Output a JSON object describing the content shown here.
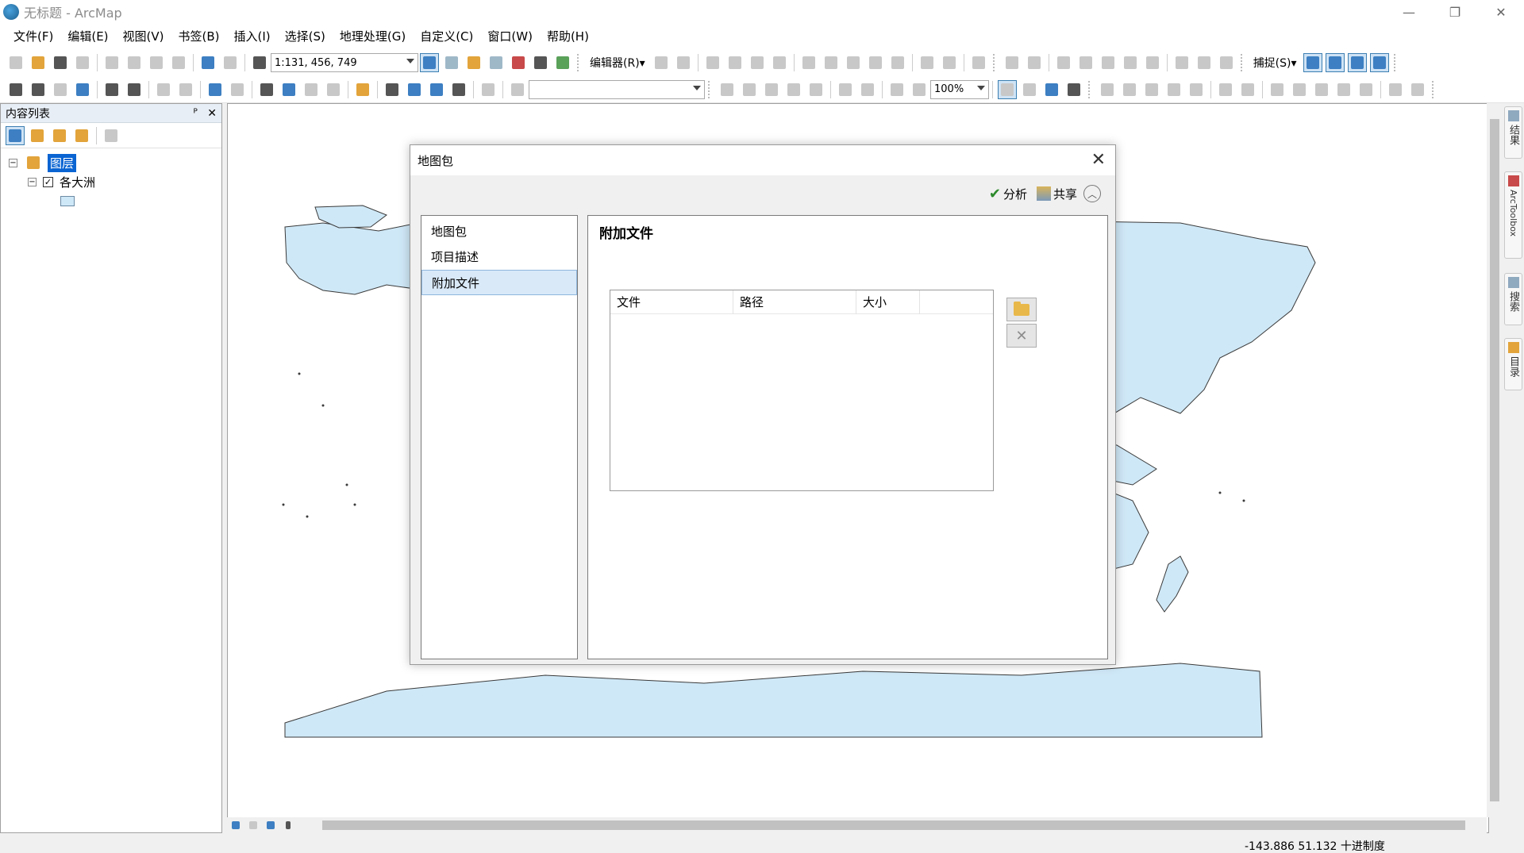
{
  "window": {
    "title": "无标题 - ArcMap",
    "minimize": "—",
    "restore": "❐",
    "close": "✕"
  },
  "menu": [
    "文件(F)",
    "编辑(E)",
    "视图(V)",
    "书签(B)",
    "插入(I)",
    "选择(S)",
    "地理处理(G)",
    "自定义(C)",
    "窗口(W)",
    "帮助(H)"
  ],
  "toolbar": {
    "scale_value": "1:131, 456, 749",
    "editor_label": "编辑器(R)▾",
    "snapping_label": "捕捉(S)▾",
    "zoom_value": "100%",
    "layer_combo_value": ""
  },
  "toc": {
    "title": "内容列表",
    "pin": "ᴾ",
    "close": "✕",
    "layers_root": "图层",
    "layer_name": "各大洲",
    "layers_expander": "−",
    "layer_expander": "−",
    "layer_checked": "✓"
  },
  "side_tabs": [
    "结果",
    "ArcToolbox",
    "搜索",
    "目录"
  ],
  "status": {
    "coordinates": "-143.886  51.132 十进制度"
  },
  "dialog": {
    "title": "地图包",
    "close": "✕",
    "analyze_label": "分析",
    "share_label": "共享",
    "collapse": "︿",
    "nav_items": [
      "地图包",
      "项目描述",
      "附加文件"
    ],
    "selected_nav": "附加文件",
    "content_title": "附加文件",
    "file_table_headers": [
      "文件",
      "路径",
      "大小"
    ],
    "file_rows": []
  },
  "colors": {
    "land": "#cfe8f7",
    "coast": "#3a3a3a",
    "selection": "#0a64d2"
  }
}
